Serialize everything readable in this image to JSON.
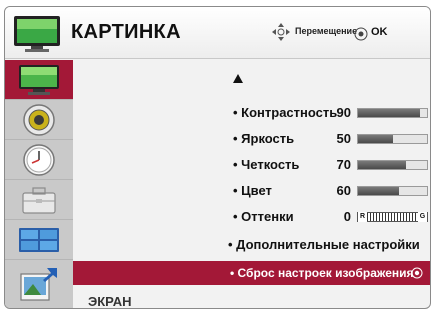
{
  "header": {
    "title": "КАРТИНКА",
    "nav_label": "Перемещение",
    "ok_label": "OK"
  },
  "sidebar": {
    "items": [
      {
        "icon": "picture-icon",
        "selected": true
      },
      {
        "icon": "speaker-icon",
        "selected": false
      },
      {
        "icon": "clock-icon",
        "selected": false
      },
      {
        "icon": "toolbox-icon",
        "selected": false
      },
      {
        "icon": "input-icon",
        "selected": false
      },
      {
        "icon": "screen-icon",
        "selected": false
      }
    ]
  },
  "menu": {
    "rows": [
      {
        "label": "• Контрастность",
        "value": "90",
        "level": 0.9
      },
      {
        "label": "• Яркость",
        "value": "50",
        "level": 0.5
      },
      {
        "label": "• Четкость",
        "value": "70",
        "level": 0.7
      },
      {
        "label": "• Цвет",
        "value": "60",
        "level": 0.6
      }
    ],
    "tint": {
      "label": "• Оттенки",
      "value": "0",
      "left_end": "R",
      "right_end": "G"
    },
    "advanced": "• Дополнительные настройки",
    "reset": "• Сброс настроек изображения"
  },
  "next_menu_label": "ЭКРАН",
  "colors": {
    "accent": "#a31837",
    "sidebar": "#c9c9c9",
    "panel": "#f2f2f2"
  }
}
